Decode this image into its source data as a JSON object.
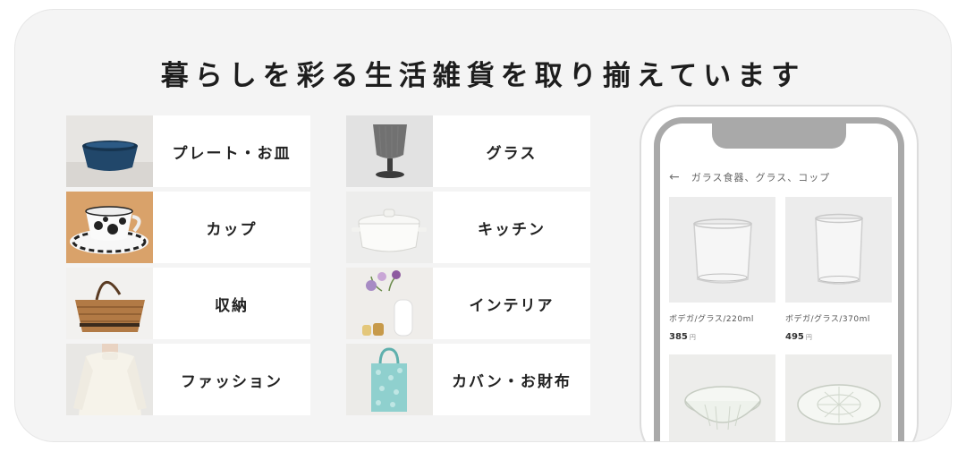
{
  "headline": "暮らしを彩る生活雑貨を取り揃えています",
  "categories": {
    "plate": {
      "label": "プレート・お皿",
      "icon": "bowl-photo"
    },
    "glass": {
      "label": "グラス",
      "icon": "goblet-photo"
    },
    "cup": {
      "label": "カップ",
      "icon": "cup-saucer-photo"
    },
    "kitchen": {
      "label": "キッチン",
      "icon": "pot-photo"
    },
    "storage": {
      "label": "収納",
      "icon": "basket-photo"
    },
    "interior": {
      "label": "インテリア",
      "icon": "vase-photo"
    },
    "fashion": {
      "label": "ファッション",
      "icon": "sweater-photo"
    },
    "bag": {
      "label": "カバン・お財布",
      "icon": "tote-bag-photo"
    }
  },
  "phone": {
    "header_title": "ガラス食器、グラス、コップ",
    "back_glyph": "←",
    "products": [
      {
        "name": "ボデガ/グラス/220ml",
        "price": "385",
        "currency": "円"
      },
      {
        "name": "ボデガ/グラス/370ml",
        "price": "495",
        "currency": "円"
      },
      {
        "name": "",
        "price": "",
        "currency": ""
      },
      {
        "name": "",
        "price": "",
        "currency": ""
      }
    ]
  },
  "colors": {
    "card_bg": "#f4f4f4",
    "phone_frame": "#a9a9a9",
    "bowl_blue": "#21476a"
  }
}
